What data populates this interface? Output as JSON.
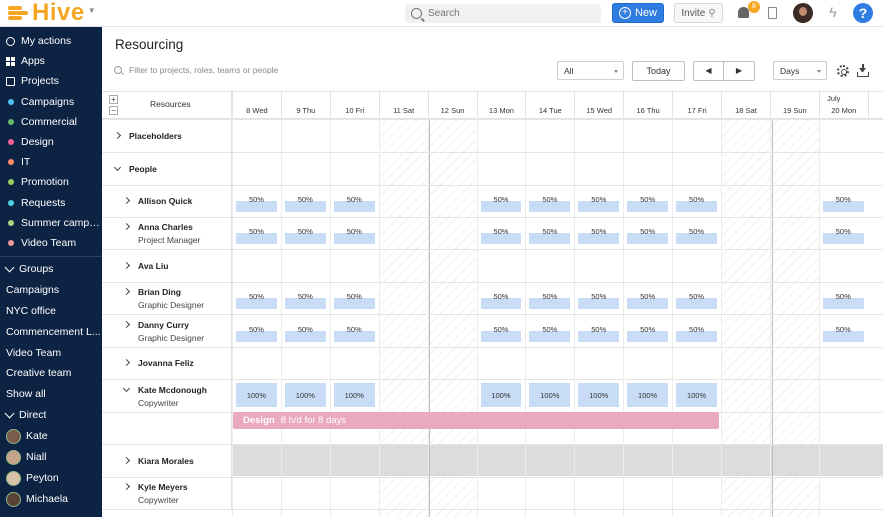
{
  "app": {
    "logo": "Hive"
  },
  "topbar": {
    "search_placeholder": "Search",
    "new_label": "New",
    "invite_label": "Invite",
    "notification_count": "8"
  },
  "sidebar": {
    "nav": [
      {
        "label": "My actions",
        "icon": "check-circle-icon"
      },
      {
        "label": "Apps",
        "icon": "grid-icon"
      },
      {
        "label": "Projects",
        "icon": "folder-icon"
      }
    ],
    "projects": [
      {
        "label": "Campaigns",
        "color": "#4fc3f7"
      },
      {
        "label": "Commercial",
        "color": "#66bb6a"
      },
      {
        "label": "Design",
        "color": "#f06292"
      },
      {
        "label": "IT",
        "color": "#ff8a65"
      },
      {
        "label": "Promotion",
        "color": "#9ccc65"
      },
      {
        "label": "Requests",
        "color": "#4dd0e1"
      },
      {
        "label": "Summer campa...",
        "color": "#aed581"
      },
      {
        "label": "Video Team",
        "color": "#ef9a9a"
      }
    ],
    "groups_header": "Groups",
    "groups": [
      "Campaigns",
      "NYC office",
      "Commencement L...",
      "Video Team",
      "Creative team",
      "Show all"
    ],
    "direct_header": "Direct",
    "direct": [
      {
        "label": "Kate",
        "color": "#7a5a48"
      },
      {
        "label": "Niall",
        "color": "#c7a28a"
      },
      {
        "label": "Peyton",
        "color": "#d8c2a8"
      },
      {
        "label": "Michaela",
        "color": "#5b4236"
      }
    ]
  },
  "main": {
    "title": "Resourcing",
    "filter_placeholder": "Filter to projects, roles, teams or people",
    "filter_select": "All",
    "today_label": "Today",
    "prev_label": "◀",
    "next_label": "▶",
    "view_select": "Days",
    "resources_header": "Resources",
    "expand_label": "+",
    "collapse_label": "−",
    "month_label": "July",
    "days": [
      "8 Wed",
      "9 Thu",
      "10 Fri",
      "11 Sat",
      "12 Sun",
      "13 Mon",
      "14 Tue",
      "15 Wed",
      "16 Thu",
      "17 Fri",
      "18 Sat",
      "19 Sun",
      "20 Mon"
    ],
    "rows": [
      {
        "name": "Placeholders",
        "role": "",
        "type": "group",
        "values": []
      },
      {
        "name": "People",
        "role": "",
        "type": "group",
        "values": []
      },
      {
        "name": "Allison Quick",
        "role": "",
        "type": "person",
        "values": [
          "50%",
          "50%",
          "50%",
          "",
          "",
          "50%",
          "50%",
          "50%",
          "50%",
          "50%",
          "",
          "",
          "50%"
        ]
      },
      {
        "name": "Anna Charles",
        "role": "Project Manager",
        "type": "person",
        "values": [
          "50%",
          "50%",
          "50%",
          "",
          "",
          "50%",
          "50%",
          "50%",
          "50%",
          "50%",
          "",
          "",
          "50%"
        ]
      },
      {
        "name": "Ava Liu",
        "role": "",
        "type": "person",
        "values": []
      },
      {
        "name": "Brian Ding",
        "role": "Graphic Designer",
        "type": "person",
        "values": [
          "50%",
          "50%",
          "50%",
          "",
          "",
          "50%",
          "50%",
          "50%",
          "50%",
          "50%",
          "",
          "",
          "50%"
        ]
      },
      {
        "name": "Danny Curry",
        "role": "Graphic Designer",
        "type": "person",
        "values": [
          "50%",
          "50%",
          "50%",
          "",
          "",
          "50%",
          "50%",
          "50%",
          "50%",
          "50%",
          "",
          "",
          "50%"
        ]
      },
      {
        "name": "Jovanna Feliz",
        "role": "",
        "type": "person",
        "values": []
      },
      {
        "name": "Kate Mcdonough",
        "role": "Copywriter",
        "type": "person-open",
        "values": [
          "100%",
          "100%",
          "100%",
          "",
          "",
          "100%",
          "100%",
          "100%",
          "100%",
          "100%",
          "",
          "",
          ""
        ]
      },
      {
        "name": "",
        "role": "",
        "type": "task",
        "values": []
      },
      {
        "name": "Kiara Morales",
        "role": "",
        "type": "person",
        "values": []
      },
      {
        "name": "Kyle Meyers",
        "role": "Copywriter",
        "type": "person",
        "values": []
      }
    ],
    "task": {
      "project": "Design",
      "detail": "8 h/d for 8 days",
      "color": "#e9a9bf"
    }
  }
}
